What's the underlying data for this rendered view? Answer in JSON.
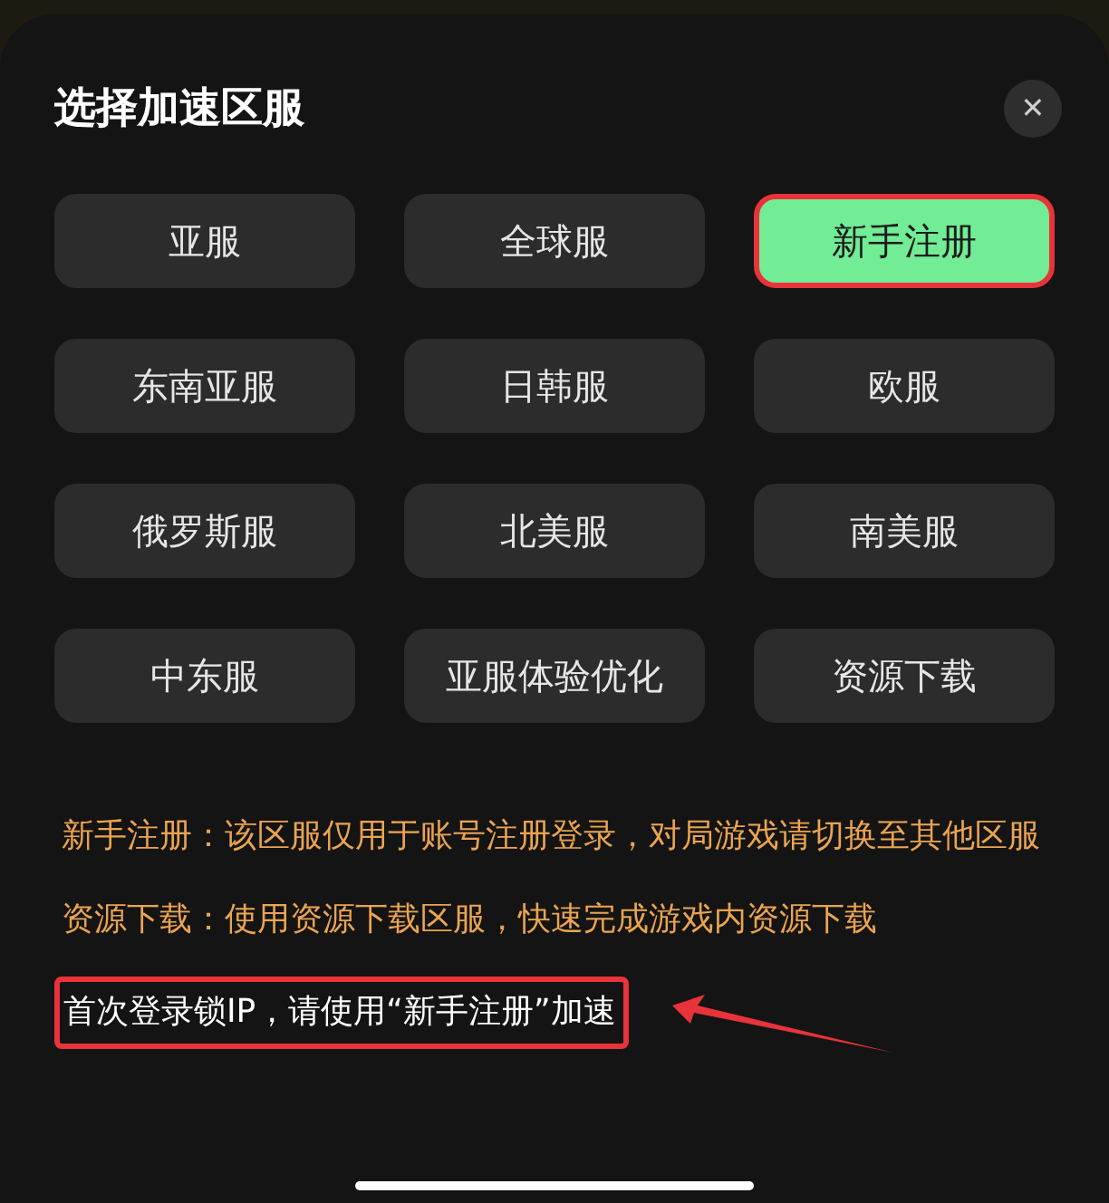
{
  "dialog": {
    "title": "选择加速区服",
    "close_label": "✕"
  },
  "regions": [
    {
      "label": "亚服",
      "selected": false,
      "annotated": false
    },
    {
      "label": "全球服",
      "selected": false,
      "annotated": false
    },
    {
      "label": "新手注册",
      "selected": true,
      "annotated": true
    },
    {
      "label": "东南亚服",
      "selected": false,
      "annotated": false
    },
    {
      "label": "日韩服",
      "selected": false,
      "annotated": false
    },
    {
      "label": "欧服",
      "selected": false,
      "annotated": false
    },
    {
      "label": "俄罗斯服",
      "selected": false,
      "annotated": false
    },
    {
      "label": "北美服",
      "selected": false,
      "annotated": false
    },
    {
      "label": "南美服",
      "selected": false,
      "annotated": false
    },
    {
      "label": "中东服",
      "selected": false,
      "annotated": false
    },
    {
      "label": "亚服体验优化",
      "selected": false,
      "annotated": false
    },
    {
      "label": "资源下载",
      "selected": false,
      "annotated": false
    }
  ],
  "notes": [
    {
      "term": "新手注册：",
      "text": "该区服仅用于账号注册登录，对局游戏请切换至其他区服"
    },
    {
      "term": "资源下载：",
      "text": "使用资源下载区服，快速完成游戏内资源下载"
    }
  ],
  "notice": {
    "text": "首次登录锁IP，请使用“新手注册”加速",
    "annotated": true
  }
}
